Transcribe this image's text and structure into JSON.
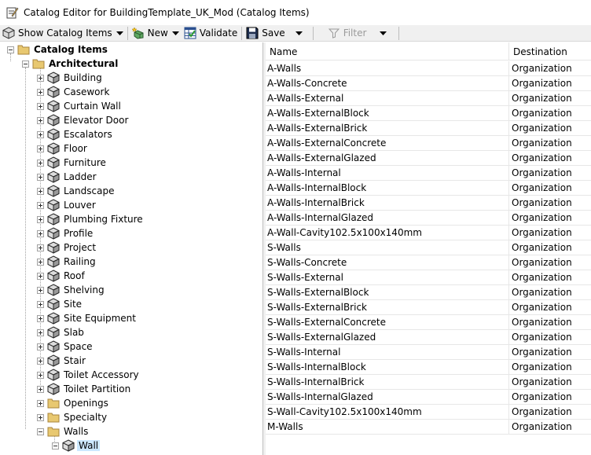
{
  "window": {
    "title": "Catalog Editor for BuildingTemplate_UK_Mod (Catalog Items)"
  },
  "toolbar": {
    "show_catalog_items": "Show Catalog Items",
    "new": "New",
    "validate": "Validate",
    "save": "Save",
    "filter": "Filter"
  },
  "tree": {
    "root": "Catalog Items",
    "architectural": "Architectural",
    "arch_children": [
      "Building",
      "Casework",
      "Curtain Wall",
      "Elevator Door",
      "Escalators",
      "Floor",
      "Furniture",
      "Ladder",
      "Landscape",
      "Louver",
      "Plumbing Fixture",
      "Profile",
      "Project",
      "Railing",
      "Roof",
      "Shelving",
      "Site",
      "Site Equipment",
      "Slab",
      "Space",
      "Stair",
      "Toilet Accessory",
      "Toilet Partition"
    ],
    "folder_children": [
      "Openings",
      "Specialty",
      "Walls"
    ],
    "walls_child": "Wall"
  },
  "list": {
    "columns": [
      "Name",
      "Destination"
    ],
    "rows": [
      {
        "name": "A-Walls",
        "destination": "Organization"
      },
      {
        "name": "A-Walls-Concrete",
        "destination": "Organization"
      },
      {
        "name": "A-Walls-External",
        "destination": "Organization"
      },
      {
        "name": "A-Walls-ExternalBlock",
        "destination": "Organization"
      },
      {
        "name": "A-Walls-ExternalBrick",
        "destination": "Organization"
      },
      {
        "name": "A-Walls-ExternalConcrete",
        "destination": "Organization"
      },
      {
        "name": "A-Walls-ExternalGlazed",
        "destination": "Organization"
      },
      {
        "name": "A-Walls-Internal",
        "destination": "Organization"
      },
      {
        "name": "A-Walls-InternalBlock",
        "destination": "Organization"
      },
      {
        "name": "A-Walls-InternalBrick",
        "destination": "Organization"
      },
      {
        "name": "A-Walls-InternalGlazed",
        "destination": "Organization"
      },
      {
        "name": "A-Wall-Cavity102.5x100x140mm",
        "destination": "Organization"
      },
      {
        "name": "S-Walls",
        "destination": "Organization"
      },
      {
        "name": "S-Walls-Concrete",
        "destination": "Organization"
      },
      {
        "name": "S-Walls-External",
        "destination": "Organization"
      },
      {
        "name": "S-Walls-ExternalBlock",
        "destination": "Organization"
      },
      {
        "name": "S-Walls-ExternalBrick",
        "destination": "Organization"
      },
      {
        "name": "S-Walls-ExternalConcrete",
        "destination": "Organization"
      },
      {
        "name": "S-Walls-ExternalGlazed",
        "destination": "Organization"
      },
      {
        "name": "S-Walls-Internal",
        "destination": "Organization"
      },
      {
        "name": "S-Walls-InternalBlock",
        "destination": "Organization"
      },
      {
        "name": "S-Walls-InternalBrick",
        "destination": "Organization"
      },
      {
        "name": "S-Walls-InternalGlazed",
        "destination": "Organization"
      },
      {
        "name": "S-Wall-Cavity102.5x100x140mm",
        "destination": "Organization"
      },
      {
        "name": "M-Walls",
        "destination": "Organization"
      }
    ]
  },
  "colors": {
    "selection": "#cce8ff",
    "toolbar_bg": "#f0f0f0",
    "folder": "#e8c870"
  },
  "icons": {
    "app": "catalog-editor-icon",
    "show": "catalog-cube-icon",
    "new": "new-item-icon",
    "validate": "validate-grid-icon",
    "save": "floppy-disk-icon",
    "filter": "funnel-icon",
    "folder": "folder-icon",
    "item": "cube-icon"
  }
}
